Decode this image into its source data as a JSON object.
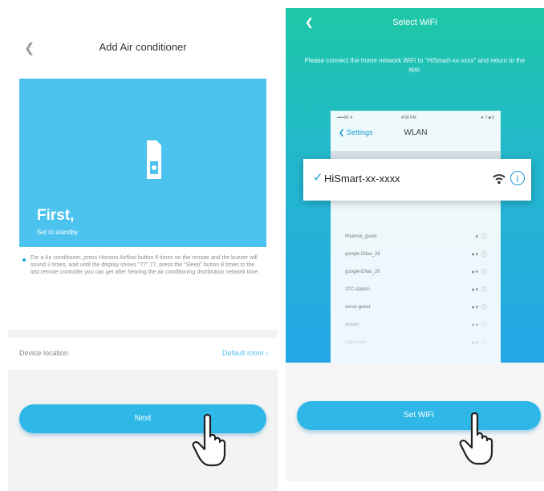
{
  "left_screen": {
    "header": {
      "back_icon": "chevron-left-icon",
      "title": "Add Air conditioner"
    },
    "hero": {
      "title": "First,",
      "subtitle": "Set to standby",
      "device_icon": "ac-remote-icon"
    },
    "instruction": "For a Air conditioner, press Horizon Airflow button 6 times on the remote and the buzzer will sound 3 times, wait until the display shows \"77\" 77, press the \"Sleep\" button 8 times to the last remote controller you can get after hearing the air conditioning distribution network tone.",
    "location": {
      "label": "Device location",
      "value": "Default room"
    },
    "next_button": {
      "label": "Next"
    }
  },
  "right_screen": {
    "header": {
      "back_icon": "chevron-left-icon",
      "title": "Select WiFi"
    },
    "instruction": "Please connect the home network WiFi to \"HiSmart-xx-xxxx\" and return to the app.",
    "mock_phone": {
      "status_left": "•••••00 ✈",
      "status_center": "4:56 PM",
      "status_right": "✦ 7 ■ 0",
      "back_label": "Settings",
      "title": "WLAN",
      "networks": [
        "Hisense_guest",
        "google-Ditax_26",
        "google-Ditax_26",
        "zTC-station",
        "xerox-guest",
        "Airport",
        "mgnl-xxxx"
      ]
    },
    "wifi_card": {
      "check_icon": "checkmark-icon",
      "ssid": "HiSmart-xx-xxxx",
      "wifi_icon": "wifi-icon",
      "info_icon": "info-icon"
    },
    "set_wifi_button": {
      "label": "Set WiFi"
    }
  },
  "colors": {
    "hero_blue": "#4cc3ee",
    "button_blue": "#2fb7e8",
    "gradient_top": "#1ec8a6",
    "gradient_bottom": "#25a6e6"
  },
  "cursor_icon": "hand-pointer-icon"
}
